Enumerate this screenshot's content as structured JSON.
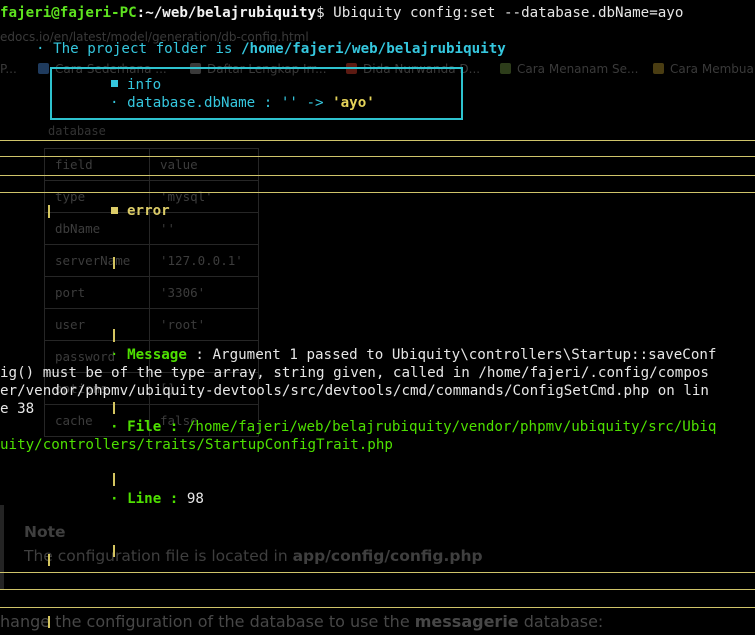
{
  "browser_bg": {
    "url": "edocs.io/en/latest/model/generation/db-config.html",
    "bookmarks": [
      {
        "label": "P...",
        "icon": "page-icon",
        "color": "#2a2a2a"
      },
      {
        "label": "Cara Sederhana ...",
        "icon": "puzzle-icon",
        "color": "#1f3b5e"
      },
      {
        "label": "Daftar Lengkap Irr...",
        "icon": "page-icon",
        "color": "#3a3a3a"
      },
      {
        "label": "Dida Nurwanda D...",
        "icon": "youtube-icon",
        "color": "#5c1a12"
      },
      {
        "label": "Cara Menanam Se...",
        "icon": "leaf-icon",
        "color": "#2d3d1a"
      },
      {
        "label": "Cara Membua",
        "icon": "leaf-icon",
        "color": "#4a3d12"
      }
    ],
    "db_label": "database",
    "table": {
      "headers": [
        "field",
        "value"
      ],
      "rows": [
        [
          "type",
          "'mysql'"
        ],
        [
          "dbName",
          "''"
        ],
        [
          "serverName",
          "'127.0.0.1'"
        ],
        [
          "port",
          "'3306'"
        ],
        [
          "user",
          "'root'"
        ],
        [
          "password",
          "''"
        ],
        [
          "options",
          "[]"
        ],
        [
          "cache",
          "false"
        ]
      ]
    },
    "note": {
      "title": "Note",
      "text_prefix": "The configuration file is located in ",
      "text_path": "app/config/config.php"
    },
    "change_line": {
      "prefix": "hange the configuration of the database to use the ",
      "bold": "messagerie",
      "suffix": " database:"
    }
  },
  "terminal": {
    "prompt_user": "fajeri@fajeri-PC",
    "prompt_sep": ":",
    "prompt_path": "~/web/belajrubiquity",
    "prompt_symbol": "$",
    "command": " Ubiquity config:set --database.dbName=ayo",
    "project_line_prefix": "· The project folder is ",
    "project_folder": "/home/fajeri/web/belajrubiquity",
    "info": {
      "title": "info",
      "line_prefix": "· database.dbName : '' -> ",
      "line_value": "'ayo'"
    },
    "error": {
      "title": "error",
      "message_label": "Message",
      "message_sep": " : ",
      "message_lines": [
        "Argument 1 passed to Ubiquity\\controllers\\Startup::saveConf",
        "ig() must be of the type array, string given, called in /home/fajeri/.config/compos",
        "er/vendor/phpmv/ubiquity-devtools/src/devtools/cmd/commands/ConfigSetCmd.php on lin",
        "e 38"
      ],
      "file_label": "· File : ",
      "file_lines": [
        "/home/fajeri/web/belajrubiquity/vendor/phpmv/ubiquity/src/Ubiq",
        "uity/controllers/traits/StartupConfigTrait.php"
      ],
      "line_label": "· Line : ",
      "line_value": "98"
    }
  },
  "colors": {
    "prompt": "#5ee31f",
    "info_box": "#2ec3cf",
    "error_frame": "#d4c560",
    "text_green": "#4ee000"
  }
}
